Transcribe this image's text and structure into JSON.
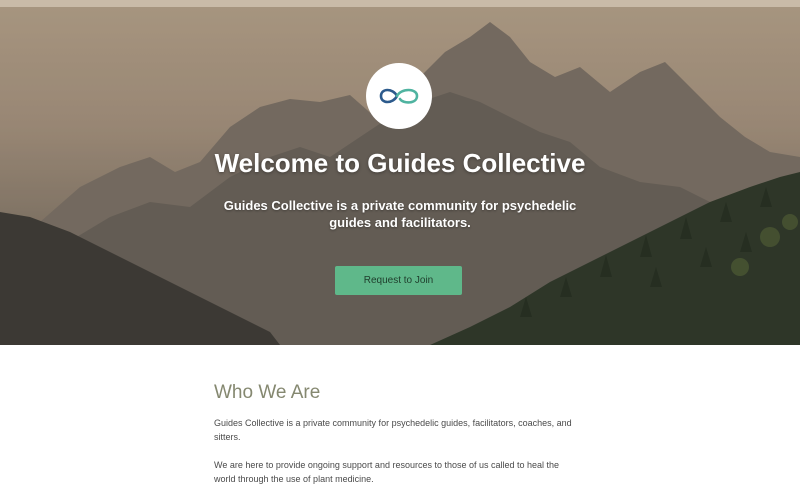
{
  "hero": {
    "title": "Welcome to Guides Collective",
    "subtitle": "Guides Collective is a private community for psychedelic guides and facilitators.",
    "cta_label": "Request to Join",
    "logo_icon": "infinity-gc-logo-icon"
  },
  "about": {
    "title": "Who We Are",
    "paragraphs": [
      "Guides Collective is a private community for psychedelic guides, facilitators, coaches, and sitters.",
      "We are here to provide ongoing support and resources to those of us called to heal the world through the use of plant medicine."
    ]
  },
  "colors": {
    "accent_green": "#5fb88a",
    "heading_olive": "#858870",
    "logo_blue": "#2c5a8c",
    "logo_teal": "#4fb3a0"
  }
}
